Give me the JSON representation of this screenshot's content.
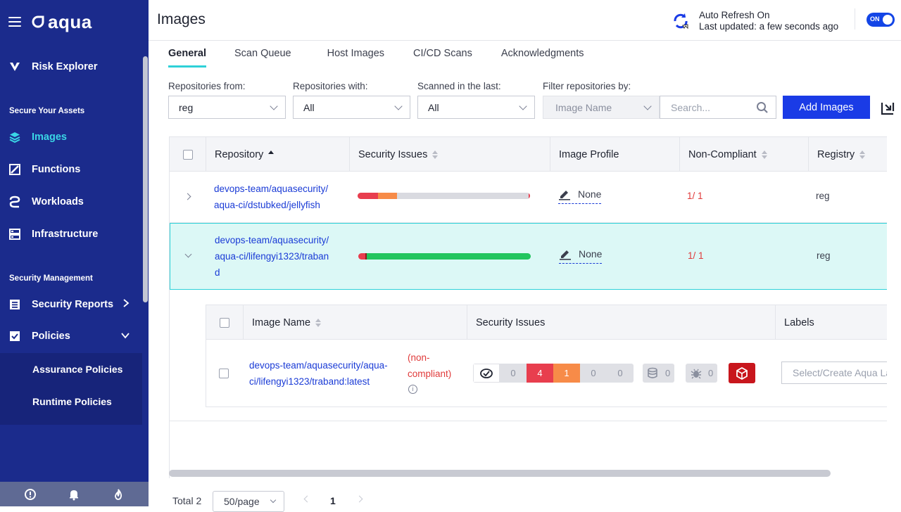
{
  "sidebar": {
    "brand": "aqua",
    "items": {
      "risk_explorer": "Risk Explorer",
      "images": "Images",
      "functions": "Functions",
      "workloads": "Workloads",
      "infrastructure": "Infrastructure",
      "security_reports": "Security Reports",
      "policies": "Policies",
      "assurance_policies": "Assurance Policies",
      "runtime_policies": "Runtime Policies"
    },
    "sections": {
      "secure_assets": "Secure Your Assets",
      "security_management": "Security Management"
    }
  },
  "header": {
    "title": "Images",
    "auto_refresh": "Auto Refresh On",
    "last_updated": "Last updated: a few seconds ago",
    "toggle_label": "ON"
  },
  "tabs": [
    "General",
    "Scan Queue",
    "Host Images",
    "CI/CD Scans",
    "Acknowledgments"
  ],
  "filters": {
    "repositories_from": {
      "label": "Repositories from:",
      "value": "reg"
    },
    "repositories_with": {
      "label": "Repositories with:",
      "value": "All"
    },
    "scanned_in_last": {
      "label": "Scanned in the last:",
      "value": "All"
    },
    "filter_by": {
      "label": "Filter repositories by:",
      "value": "Image Name"
    },
    "search_placeholder": "Search...",
    "add_images": "Add Images"
  },
  "table": {
    "columns": [
      "Repository",
      "Security Issues",
      "Image Profile",
      "Non-Compliant",
      "Registry"
    ],
    "rows": [
      {
        "repo_line1": "devops-team/aquasecurity/",
        "repo_line2": "aqua-ci/dstubked/jellyfish",
        "profile": "None",
        "noncompliant": "1/ 1",
        "registry": "reg"
      },
      {
        "repo_line1": "devops-team/aquasecurity/",
        "repo_line2": "aqua-ci/lifengyi1323/traban",
        "repo_line3": "d",
        "profile": "None",
        "noncompliant": "1/ 1",
        "registry": "reg"
      }
    ]
  },
  "nested": {
    "columns": [
      "Image Name",
      "Security Issues",
      "Labels"
    ],
    "image_line1": "devops-team/aquasecurity/aqua-",
    "image_line2": "ci/lifengyi1323/traband:latest",
    "status_line1": "(non-",
    "status_line2": "compliant)",
    "cve_counts": [
      "0",
      "4",
      "1",
      "0",
      "0"
    ],
    "malware_count": "0",
    "sensitive_count": "0",
    "label_placeholder": "Select/Create Aqua Label"
  },
  "pagination": {
    "total": "Total 2",
    "page_size": "50/page",
    "current_page": "1"
  },
  "colors": {
    "sidebar_bg": "#1b2b8c",
    "accent_cyan": "#2fd1d8",
    "primary_blue": "#1a3be6",
    "critical": "#e83e4e",
    "high": "#f78b48",
    "ok_green": "#22c55e"
  }
}
